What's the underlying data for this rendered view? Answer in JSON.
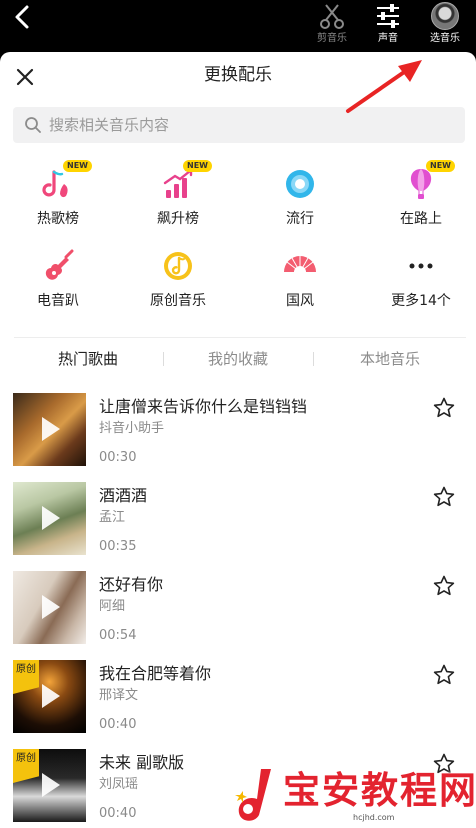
{
  "topbar": {
    "tools": [
      {
        "label": "剪音乐",
        "icon": "scissors-icon"
      },
      {
        "label": "声音",
        "icon": "sliders-icon"
      },
      {
        "label": "选音乐",
        "icon": "avatar-icon"
      }
    ]
  },
  "sheet": {
    "title": "更换配乐"
  },
  "search": {
    "placeholder": "搜索相关音乐内容"
  },
  "categories": [
    {
      "label": "热歌榜",
      "badge": "NEW",
      "icon": "hot-chart-icon",
      "color": "#f0477b"
    },
    {
      "label": "飙升榜",
      "badge": "NEW",
      "icon": "rising-chart-icon",
      "color": "#e8418c"
    },
    {
      "label": "流行",
      "badge": "",
      "icon": "pop-disc-icon",
      "color": "#31b6ea"
    },
    {
      "label": "在路上",
      "badge": "NEW",
      "icon": "balloon-icon",
      "color": "#e14fd0"
    },
    {
      "label": "电音趴",
      "badge": "",
      "icon": "electric-guitar-icon",
      "color": "#f04f6a"
    },
    {
      "label": "原创音乐",
      "badge": "",
      "icon": "original-music-icon",
      "color": "#f7c21a"
    },
    {
      "label": "国风",
      "badge": "",
      "icon": "folding-fan-icon",
      "color": "#f35d70"
    },
    {
      "label": "更多14个",
      "badge": "",
      "icon": "more-dots-icon",
      "color": "#222222"
    }
  ],
  "tabs": [
    "热门歌曲",
    "我的收藏",
    "本地音乐"
  ],
  "songs": [
    {
      "title": "让唐僧来告诉你什么是铛铛铛",
      "artist": "抖音小助手",
      "duration": "00:30",
      "original": false
    },
    {
      "title": "酒酒酒",
      "artist": "孟江",
      "duration": "00:35",
      "original": false
    },
    {
      "title": "还好有你",
      "artist": "阿细",
      "duration": "00:54",
      "original": false
    },
    {
      "title": "我在合肥等着你",
      "artist": "邢译文",
      "duration": "00:40",
      "original": true,
      "tag": "原创"
    },
    {
      "title": "未来 副歌版",
      "artist": "刘凤瑶",
      "duration": "00:40",
      "original": true,
      "tag": "原创"
    }
  ],
  "watermark": {
    "text": "宝安教程网",
    "url": "hcjhd.com"
  },
  "colors": {
    "accent_red": "#e3232f",
    "badge_yellow": "#ffd400"
  }
}
